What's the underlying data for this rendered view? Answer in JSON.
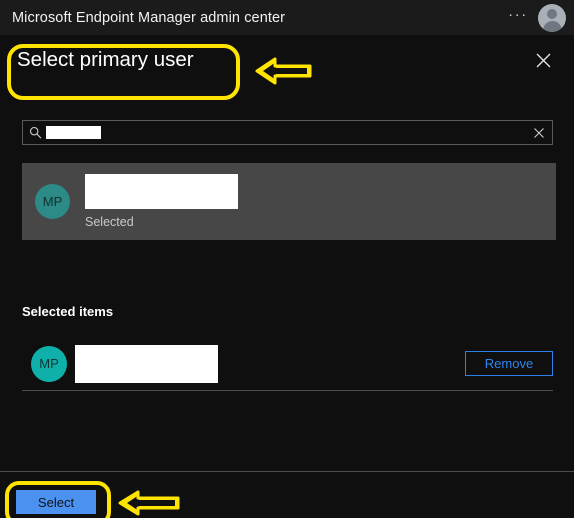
{
  "topbar": {
    "title": "Microsoft Endpoint Manager admin center",
    "more_label": "···",
    "avatar_name": "user-avatar"
  },
  "panel": {
    "title": "Select primary user",
    "close_label": "Close"
  },
  "search": {
    "value_redacted": "",
    "placeholder": "",
    "clear_label": "Clear",
    "icon": "search-icon"
  },
  "results": [
    {
      "initials": "MP",
      "name_redacted": "",
      "status": "Selected"
    }
  ],
  "selected_items": {
    "heading": "Selected items",
    "items": [
      {
        "initials": "MP",
        "name_redacted": "",
        "remove_label": "Remove"
      }
    ]
  },
  "footer": {
    "select_label": "Select"
  },
  "annotations": [
    {
      "type": "rounded-rect",
      "target": "panel-title",
      "color": "#ffe400"
    },
    {
      "type": "arrow-left",
      "target": "panel-title",
      "color": "#ffe400"
    },
    {
      "type": "rounded-rect",
      "target": "select-button",
      "color": "#ffe400"
    },
    {
      "type": "arrow-left",
      "target": "select-button",
      "color": "#ffe400"
    }
  ],
  "colors": {
    "topbar_bg": "#1b1b1b",
    "panel_bg": "#0f0f0f",
    "result_row_bg": "#474747",
    "avatar_teal": "#2c8a87",
    "avatar_teal_bright": "#0fb0aa",
    "accent_blue": "#2f86ef",
    "primary_button": "#4b92f0",
    "annotation_yellow": "#ffe400"
  }
}
